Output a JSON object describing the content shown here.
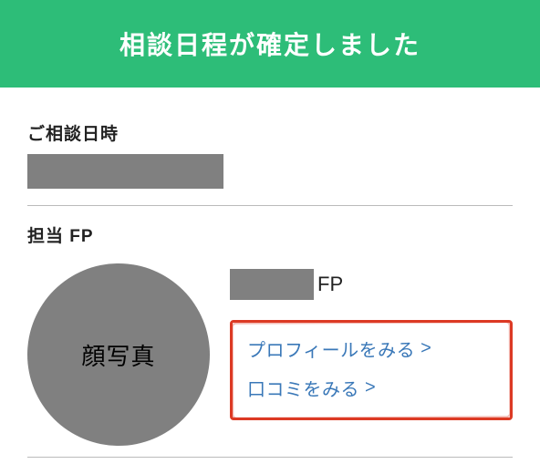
{
  "header": {
    "title": "相談日程が確定しました"
  },
  "consult": {
    "date_label": "ご相談日時",
    "date_value": ""
  },
  "fp": {
    "section_label": "担当 FP",
    "avatar_text": "顔写真",
    "name_value": "",
    "name_suffix": "FP",
    "links": {
      "profile": "プロフィールをみる",
      "reviews": "口コミをみる",
      "chevron": ">"
    }
  }
}
